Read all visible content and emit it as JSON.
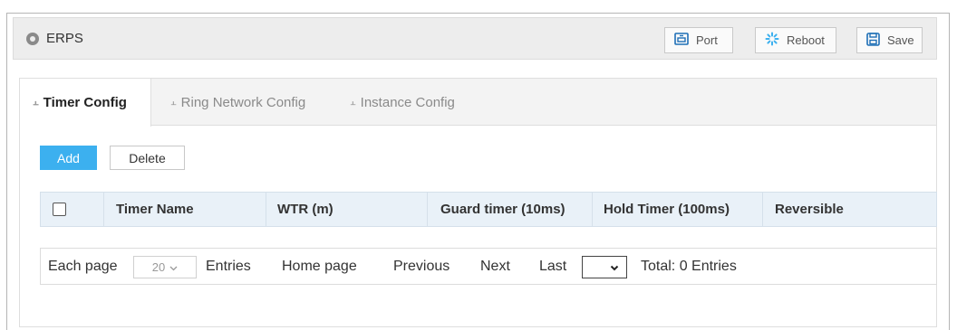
{
  "header": {
    "title": "ERPS",
    "buttons": {
      "port": "Port",
      "reboot": "Reboot",
      "save": "Save"
    }
  },
  "tabs": [
    {
      "label": "Timer Config",
      "active": true
    },
    {
      "label": "Ring Network Config",
      "active": false
    },
    {
      "label": "Instance Config",
      "active": false
    }
  ],
  "actions": {
    "add": "Add",
    "delete": "Delete"
  },
  "table": {
    "columns": [
      "Timer Name",
      "WTR (m)",
      "Guard timer (10ms)",
      "Hold Timer (100ms)",
      "Reversible"
    ],
    "rows": []
  },
  "pagination": {
    "each_page": "Each page",
    "page_size": "20",
    "entries_label": "Entries",
    "home": "Home page",
    "previous": "Previous",
    "next": "Next",
    "last": "Last",
    "page_select_value": "",
    "total": "Total: 0 Entries"
  },
  "colors": {
    "accent": "#3cb0ef",
    "header_bg": "#e9f1f8",
    "titlebar_bg": "#ededed",
    "icon_blue": "#1e6fb6"
  },
  "icons": {
    "port": "port-icon",
    "reboot": "reboot-icon",
    "save": "save-icon"
  }
}
